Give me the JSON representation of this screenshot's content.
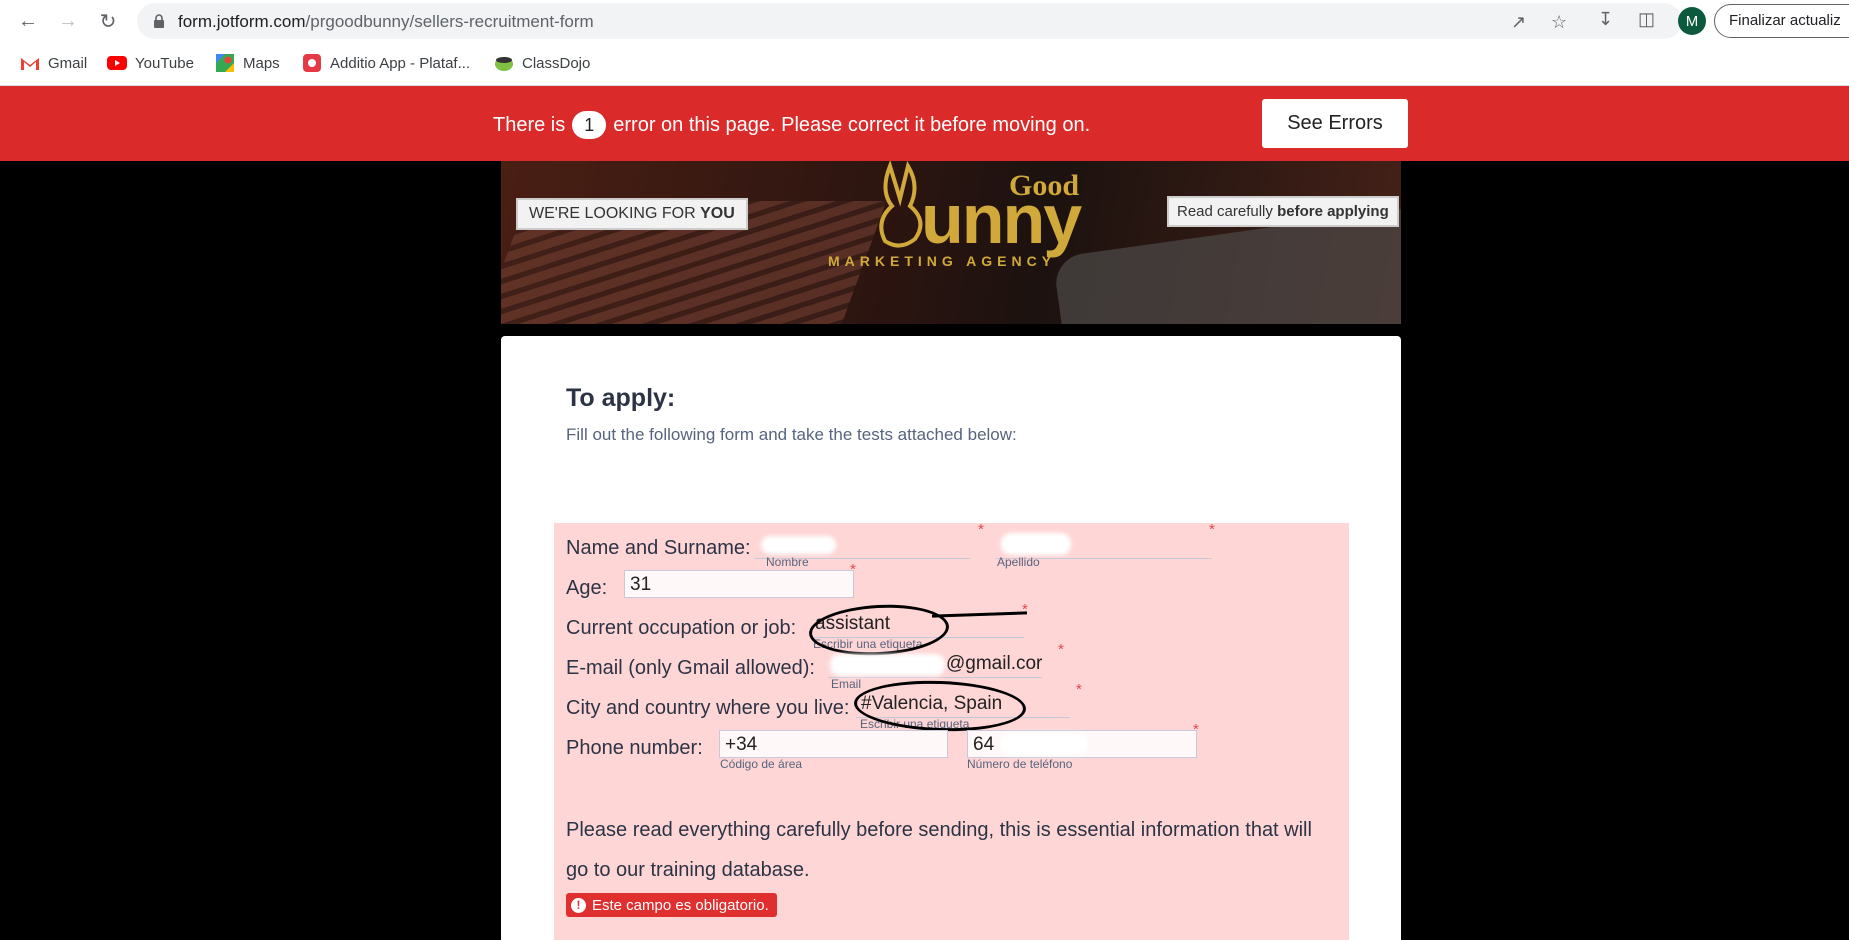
{
  "browser": {
    "url_domain": "form.jotform.com",
    "url_path": "/prgoodbunny/sellers-recruitment-form",
    "profile_initial": "M",
    "finalize_label": "Finalizar actualiz",
    "bookmarks": [
      "Gmail",
      "YouTube",
      "Maps",
      "Additio App - Plataf...",
      "ClassDojo"
    ]
  },
  "banner": {
    "prefix": "There is",
    "count": "1",
    "suffix": "error on this page. Please correct it before moving on.",
    "button": "See Errors",
    "color": "#da2a2a"
  },
  "header": {
    "looking_prefix": "WE'RE LOOKING FOR ",
    "looking_bold": "YOU",
    "logo_good": "Good",
    "logo_bunny": "unny",
    "logo_agency": "MARKETING AGENCY",
    "read_prefix": "Read carefully ",
    "read_bold": "before applying"
  },
  "form": {
    "title": "To apply:",
    "subtitle": "Fill out the following form and take the tests attached below:",
    "name_label": "Name and Surname:",
    "first_sub": "Nombre",
    "last_sub": "Apellido",
    "age_label": "Age:",
    "age_value": "31",
    "occupation_label": "Current occupation or job:",
    "occupation_value": "assistant",
    "occupation_sub": "Escribir una etiqueta",
    "email_label": "E-mail (only Gmail allowed):",
    "email_value": "@gmail.cor",
    "email_sub": "Email",
    "city_label": "City and country where you live:",
    "city_value": "#Valencia, Spain",
    "city_sub": "Escribir una etiqueta",
    "phone_label": "Phone number:",
    "area_value": "+34",
    "area_sub": "Código de área",
    "phone_value": "64",
    "phone_sub": "Número de teléfono",
    "note": "Please read everything carefully before sending, this is essential information that will go to our training database.",
    "required_error": "Este campo es obligatorio.",
    "error_bg": "#ffd6d6"
  }
}
